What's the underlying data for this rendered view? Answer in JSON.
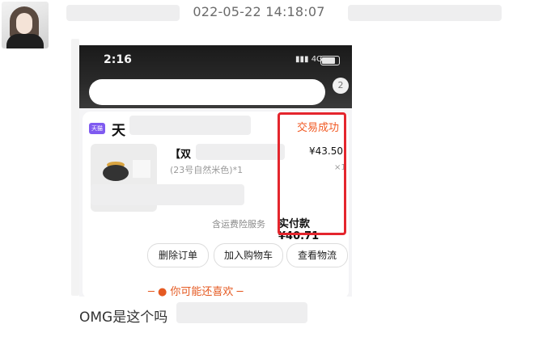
{
  "chat": {
    "timestamp": "022-05-22 14:18:07",
    "message_text": "OMG是这个吗"
  },
  "phone": {
    "status_time": "2:16",
    "network": "4G",
    "message_badge": "2"
  },
  "order": {
    "shop_icon_text": "天猫",
    "shop_name": "天",
    "status": "交易成功",
    "product_title": "【双",
    "product_spec": "(23号自然米色)*1",
    "price": "¥43.50",
    "quantity": "×1",
    "shipping_note": "含运费险服务",
    "paid_label": "实付款",
    "paid_amount": "¥40.71",
    "buttons": {
      "delete": "删除订单",
      "add_cart": "加入购物车",
      "logistics": "查看物流"
    },
    "recommend": "─ ● 你可能还喜欢 ─"
  },
  "colors": {
    "status_orange": "#f15a24",
    "highlight_red": "#e4252d",
    "shop_purple": "#7f5af0"
  }
}
